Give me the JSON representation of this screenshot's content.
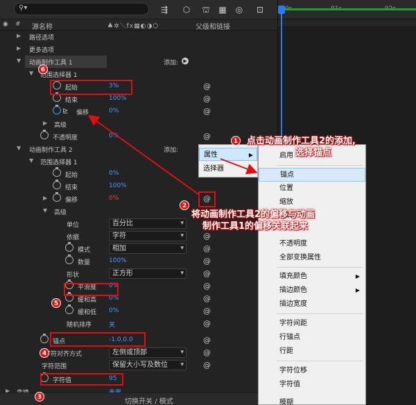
{
  "header": {
    "source_name": "源名称",
    "switch_icons": "♣✲＼fx▦◐◑⬡",
    "parent_link": "父级和链接"
  },
  "timeline": {
    "ticks": [
      "0s",
      "01s",
      "02s"
    ]
  },
  "rows": {
    "path_options": "路径选项",
    "more_options": "更多选项",
    "animator1": "动画制作工具 1",
    "add": "添加:",
    "range_selector1": "范围选择器 1",
    "start_label": "起始",
    "start_value": "3%",
    "end_label": "结束",
    "end_value": "100%",
    "offset_label": "偏移",
    "offset_value": "0%",
    "advanced": "高级",
    "opacity_label": "不透明度",
    "opacity_value": "0%",
    "animator2": "动画制作工具 2",
    "range_selector1b": "范围选择器 1",
    "start2_value": "0%",
    "end2_value": "100%",
    "offset2_value": "0%",
    "advanced2": "高级",
    "unit_label": "单位",
    "unit_value": "百分比",
    "basis_label": "依据",
    "basis_value": "字符",
    "mode_label": "模式",
    "mode_value": "相加",
    "amount_label": "数量",
    "amount_value": "100%",
    "shape_label": "形状",
    "shape_value": "正方形",
    "smoothness_label": "平滑度",
    "smoothness_value": "0%",
    "ease_high_label": "缓和高",
    "ease_high_value": "0%",
    "ease_low_label": "缓和低",
    "ease_low_value": "0%",
    "random_label": "随机排序",
    "random_value": "关",
    "anchor_label": "锚点",
    "anchor_value": "-1.0,0.0",
    "char_align_label": "字符对齐方式",
    "char_align_value": "左侧或顶部",
    "char_range_label": "字符范围",
    "char_range_value": "保留大小写及数位",
    "char_value_label": "字符值",
    "char_value_value": "95",
    "transform_label": "变换",
    "transform_value": "重置"
  },
  "bottom_bar": "切换开关 / 模式",
  "submenu": {
    "property": "属性",
    "selector": "选择器"
  },
  "menu": {
    "enable": "启用",
    "anchor": "锚点",
    "position": "位置",
    "scale": "缩放",
    "rotation": "旋转",
    "opacity": "不透明度",
    "all_transform": "全部变换属性",
    "fill_color": "填充颜色",
    "stroke_color": "描边颜色",
    "stroke_width": "描边宽度",
    "tracking": "字符间距",
    "line_anchor": "行锚点",
    "line_spacing": "行距",
    "char_offset": "字符位移",
    "char_value": "字符值",
    "blur": "模糊"
  },
  "annotations": {
    "n1": "1",
    "n2": "2",
    "n3": "3",
    "n4": "4",
    "n5": "5",
    "n6": "6",
    "text1a": "点击动画制作工具2的添加,",
    "text1b": "选择锚点",
    "text2a": "将动画制作工具2的偏移与动画",
    "text2b": "制作工具1的偏移关联起来"
  },
  "colors": {
    "value_blue": "#4b98ff",
    "value_red": "#e04444",
    "annotation_red": "#e01010",
    "work_area_green": "#1aa232",
    "playhead_blue": "#2b7bf2"
  }
}
